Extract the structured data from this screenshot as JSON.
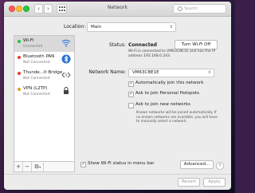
{
  "window": {
    "title": "Network",
    "search_placeholder": "Search"
  },
  "location": {
    "label": "Location:",
    "value": "Main"
  },
  "sidebar": {
    "items": [
      {
        "name": "Wi-Fi",
        "status": "Connected",
        "dot_color": "#2fbf49",
        "icon": "wifi-icon"
      },
      {
        "name": "Bluetooth PAN",
        "status": "Not Connected",
        "dot_color": "#e0442f",
        "icon": "bluetooth-icon"
      },
      {
        "name": "Thunde...lt Bridge",
        "status": "Not Connected",
        "dot_color": "#e0442f",
        "icon": "thunderbolt-bridge-icon"
      },
      {
        "name": "VPN (L2TP)",
        "status": "Not Connected",
        "dot_color": "#d9a528",
        "icon": "vpn-icon"
      }
    ],
    "add_label": "+",
    "remove_label": "−",
    "gear_label": "⚙"
  },
  "detail": {
    "status_label": "Status:",
    "status_value": "Connected",
    "turn_off_label": "Turn Wi-Fi Off",
    "status_description": "Wi-Fi is connected to VM63CBE1E and has the IP address 192.168.0.243.",
    "network_name_label": "Network Name:",
    "network_name_value": "VM63CBE1E",
    "auto_join_label": "Automatically join this network",
    "auto_join_checked": true,
    "hotspots_label": "Ask to join Personal Hotspots",
    "hotspots_checked": true,
    "new_networks_label": "Ask to join new networks",
    "new_networks_checked": false,
    "new_networks_note": "Known networks will be joined automatically. If no known networks are available, you will have to manually select a network."
  },
  "footer": {
    "show_status_label": "Show Wi-Fi status in menu bar",
    "show_status_checked": true,
    "advanced_label": "Advanced...",
    "help_label": "?",
    "revert_label": "Revert",
    "apply_label": "Apply"
  }
}
